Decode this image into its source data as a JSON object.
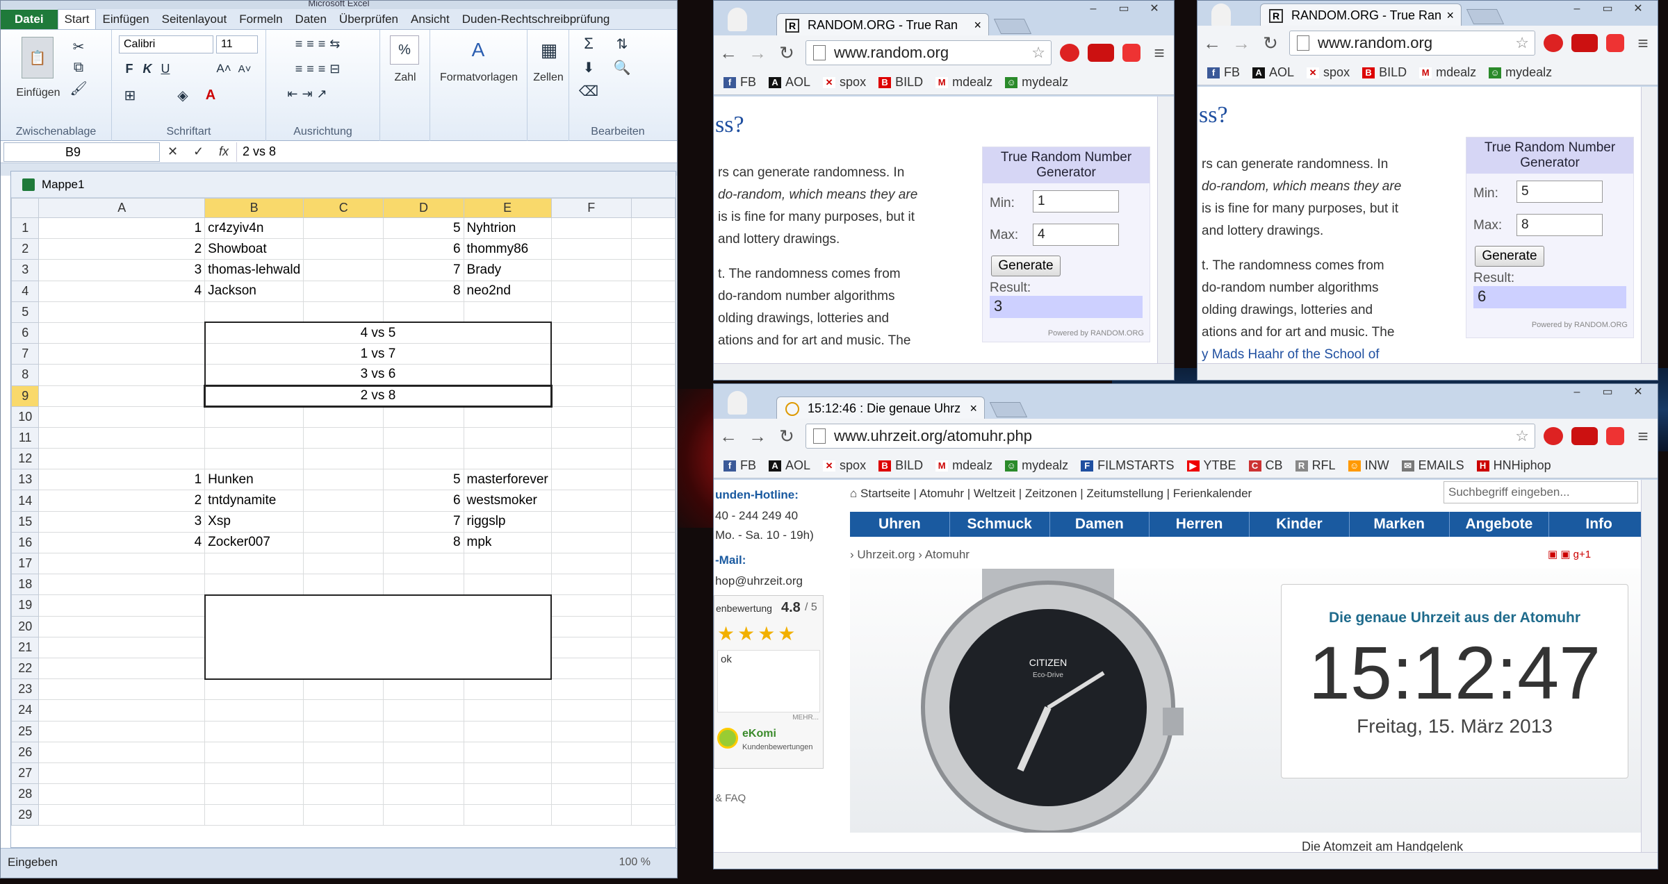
{
  "excel": {
    "title": "Microsoft Excel",
    "tabs": [
      "Datei",
      "Start",
      "Einfügen",
      "Seitenlayout",
      "Formeln",
      "Daten",
      "Überprüfen",
      "Ansicht",
      "Duden-Rechtschreibprüfung"
    ],
    "groups": [
      "Zwischenablage",
      "Schriftart",
      "Ausrichtung",
      "Zahl",
      "Formatvorlagen",
      "Zellen",
      "Bearbeiten"
    ],
    "paste_label": "Einfügen",
    "number_label": "Zahl",
    "styles_label": "Formatvorlagen",
    "cells_label": "Zellen",
    "font_name": "Calibri",
    "font_size": "11",
    "name_box": "B9",
    "formula": "2 vs 8",
    "workbook": "Mappe1",
    "columns": [
      "A",
      "B",
      "C",
      "D",
      "E",
      "F"
    ],
    "rows": [
      {
        "n": "1",
        "a": "1",
        "b": "cr4zyiv4n",
        "d": "5",
        "e": "Nyhtrion",
        "mid": ""
      },
      {
        "n": "2",
        "a": "2",
        "b": "Showboat",
        "d": "6",
        "e": "thommy86",
        "mid": ""
      },
      {
        "n": "3",
        "a": "3",
        "b": "thomas-lehwald",
        "d": "7",
        "e": "Brady",
        "mid": ""
      },
      {
        "n": "4",
        "a": "4",
        "b": "Jackson",
        "d": "8",
        "e": "neo2nd",
        "mid": ""
      },
      {
        "n": "5",
        "a": "",
        "b": "",
        "d": "",
        "e": "",
        "mid": ""
      },
      {
        "n": "6",
        "a": "",
        "b": "",
        "d": "",
        "e": "",
        "mid": "4 vs 5"
      },
      {
        "n": "7",
        "a": "",
        "b": "",
        "d": "",
        "e": "",
        "mid": "1 vs 7"
      },
      {
        "n": "8",
        "a": "",
        "b": "",
        "d": "",
        "e": "",
        "mid": "3 vs 6"
      },
      {
        "n": "9",
        "a": "",
        "b": "",
        "d": "",
        "e": "",
        "mid": "2 vs 8"
      },
      {
        "n": "10",
        "a": "",
        "b": "",
        "d": "",
        "e": "",
        "mid": ""
      },
      {
        "n": "11",
        "a": "",
        "b": "",
        "d": "",
        "e": "",
        "mid": ""
      },
      {
        "n": "12",
        "a": "",
        "b": "",
        "d": "",
        "e": "",
        "mid": ""
      },
      {
        "n": "13",
        "a": "1",
        "b": "Hunken",
        "d": "5",
        "e": "masterforever",
        "mid": ""
      },
      {
        "n": "14",
        "a": "2",
        "b": "tntdynamite",
        "d": "6",
        "e": "westsmoker",
        "mid": ""
      },
      {
        "n": "15",
        "a": "3",
        "b": "Xsp",
        "d": "7",
        "e": "riggslp",
        "mid": ""
      },
      {
        "n": "16",
        "a": "4",
        "b": "Zocker007",
        "d": "8",
        "e": "mpk",
        "mid": ""
      },
      {
        "n": "17",
        "a": "",
        "b": "",
        "d": "",
        "e": "",
        "mid": ""
      },
      {
        "n": "18",
        "a": "",
        "b": "",
        "d": "",
        "e": "",
        "mid": ""
      },
      {
        "n": "19",
        "a": "",
        "b": "",
        "d": "",
        "e": "",
        "mid": ""
      },
      {
        "n": "20",
        "a": "",
        "b": "",
        "d": "",
        "e": "",
        "mid": ""
      },
      {
        "n": "21",
        "a": "",
        "b": "",
        "d": "",
        "e": "",
        "mid": ""
      },
      {
        "n": "22",
        "a": "",
        "b": "",
        "d": "",
        "e": "",
        "mid": ""
      },
      {
        "n": "23",
        "a": "",
        "b": "",
        "d": "",
        "e": "",
        "mid": ""
      },
      {
        "n": "24",
        "a": "",
        "b": "",
        "d": "",
        "e": "",
        "mid": ""
      },
      {
        "n": "25",
        "a": "",
        "b": "",
        "d": "",
        "e": "",
        "mid": ""
      },
      {
        "n": "26",
        "a": "",
        "b": "",
        "d": "",
        "e": "",
        "mid": ""
      },
      {
        "n": "27",
        "a": "",
        "b": "",
        "d": "",
        "e": "",
        "mid": ""
      },
      {
        "n": "28",
        "a": "",
        "b": "",
        "d": "",
        "e": "",
        "mid": ""
      },
      {
        "n": "29",
        "a": "",
        "b": "",
        "d": "",
        "e": "",
        "mid": ""
      }
    ],
    "status": "Eingeben",
    "zoom": "100 %"
  },
  "random1": {
    "tab_title": "RANDOM.ORG - True Ran",
    "url": "www.random.org",
    "heading": "ss?",
    "lines": [
      "rs can generate randomness. In",
      "do-random, which means they are",
      "is is fine for many purposes, but it",
      "and lottery drawings.",
      "",
      "t. The randomness comes from",
      "do-random number algorithms",
      "olding drawings, lotteries and",
      "ations and for art and music. The"
    ],
    "widget_title": "True Random Number Generator",
    "min_label": "Min:",
    "min": "1",
    "max_label": "Max:",
    "max": "4",
    "button": "Generate",
    "result_label": "Result:",
    "result": "3",
    "powered": "Powered by RANDOM.ORG"
  },
  "random2": {
    "tab_title": "RANDOM.ORG - True Ran",
    "url": "www.random.org",
    "heading": "ss?",
    "lines": [
      "rs can generate randomness. In",
      "do-random, which means they are",
      "is is fine for many purposes, but it",
      "and lottery drawings.",
      "",
      "t. The randomness comes from",
      "do-random number algorithms",
      "olding drawings, lotteries and",
      "ations and for art and music. The",
      "y Mads Haahr of the School of"
    ],
    "widget_title": "True Random Number Generator",
    "min_label": "Min:",
    "min": "5",
    "max_label": "Max:",
    "max": "8",
    "button": "Generate",
    "result_label": "Result:",
    "result": "6",
    "powered": "Powered by RANDOM.ORG"
  },
  "bookmarks_short": [
    "FB",
    "AOL",
    "spox",
    "BILD",
    "mdealz",
    "mydealz"
  ],
  "bookmarks_long": [
    "FB",
    "AOL",
    "spox",
    "BILD",
    "mdealz",
    "mydealz",
    "FILMSTARTS",
    "YTBE",
    "CB",
    "RFL",
    "INW",
    "EMAILS",
    "HNHiphop"
  ],
  "uhrzeit": {
    "tab_title": "15:12:46 : Die genaue Uhrz",
    "url": "www.uhrzeit.org/atomuhr.php",
    "hotline": "unden-Hotline:",
    "phone": "40 - 244 249 40",
    "hours": "Mo. - Sa. 10 - 19h)",
    "mail_label": "-Mail:",
    "mail": "hop@uhrzeit.org",
    "rating_label": "enbewertung",
    "rating": "4.8",
    "rating_max": "/ 5",
    "review": "ok",
    "review_more": "MEHR...",
    "ekomi": "eKomi",
    "ekomi_sub": "Kundenbewertungen",
    "faq": "& FAQ",
    "top_links": "Startseite | Atomuhr | Weltzeit | Zeitzonen | Zeitumstellung | Ferienkalender",
    "search_placeholder": "Suchbegriff eingeben...",
    "nav": [
      "Uhren",
      "Schmuck",
      "Damen",
      "Herren",
      "Kinder",
      "Marken",
      "Angebote",
      "Info"
    ],
    "breadcrumb": "› Uhrzeit.org › Atomuhr",
    "clock_heading": "Die genaue Uhrzeit aus der Atomuhr",
    "time": "15:12:47",
    "date": "Freitag, 15. März 2013",
    "watch_brand": "CITIZEN",
    "watch_sub": "Eco-Drive",
    "footer": "Die Atomzeit am Handgelenk"
  }
}
